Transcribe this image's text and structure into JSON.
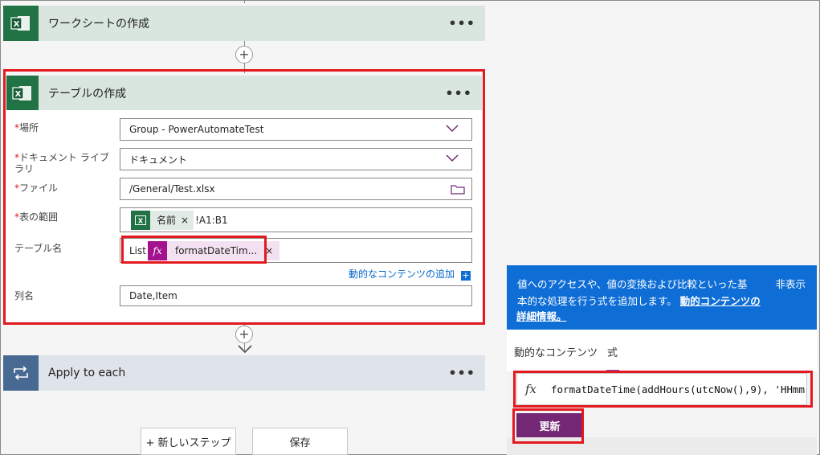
{
  "cards": {
    "worksheet": {
      "title": "ワークシートの作成",
      "more": "•••"
    },
    "table": {
      "title": "テーブルの作成",
      "more": "•••"
    },
    "apply": {
      "title": "Apply to each",
      "more": "•••"
    }
  },
  "form": {
    "location": {
      "label": "場所",
      "value": "Group - PowerAutomateTest"
    },
    "library": {
      "label_line1": "ドキュメント ライブ",
      "label_line2": "ラリ",
      "value": "ドキュメント"
    },
    "file": {
      "label": "ファイル",
      "value": "/General/Test.xlsx"
    },
    "range": {
      "label": "表の範囲",
      "token": "名前",
      "token_close": "×",
      "suffix": "!A1:B1"
    },
    "table_name": {
      "label": "テーブル名",
      "prefix": "List",
      "token": "formatDateTim...",
      "token_close": "×"
    },
    "add_dynamic": "動的なコンテンツの追加",
    "columns": {
      "label": "列名",
      "value": "Date,Item"
    },
    "required_mark": "*"
  },
  "buttons": {
    "new_step": "+ 新しいステップ",
    "save": "保存"
  },
  "panel": {
    "info_line1": "値へのアクセスや、値の変換および比較といった基",
    "info_line2_a": "本的な処理を行う式を追加します。",
    "info_link1": "動的コンテンツの",
    "info_link2": "詳細情報。",
    "hide": "非表示",
    "tabs": [
      "動的なコンテンツ",
      "式"
    ],
    "expression": "formatDateTime(addHours(utcNow(),9), 'HHmm",
    "fx": "fx",
    "update": "更新"
  },
  "colors": {
    "excel_green": "#217346",
    "accent_red": "#e3191f",
    "purple": "#742774",
    "blue": "#0f6ed6"
  }
}
